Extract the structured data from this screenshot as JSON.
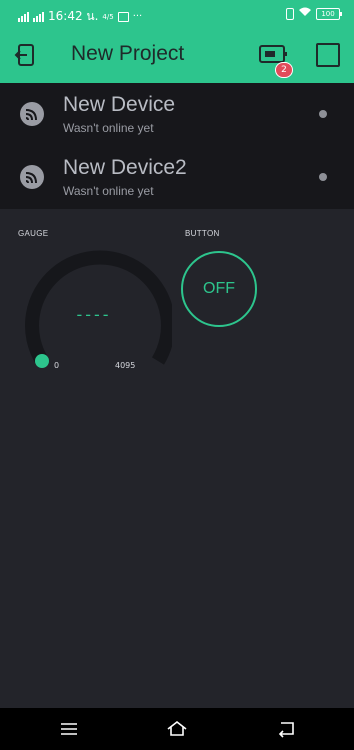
{
  "status_bar": {
    "time": "16:42 น.",
    "speed": "4/5",
    "battery": "100"
  },
  "app_bar": {
    "title": "New Project",
    "device_badge_count": "2"
  },
  "devices": [
    {
      "name": "New Device",
      "status": "Wasn't online yet"
    },
    {
      "name": "New Device2",
      "status": "Wasn't online yet"
    }
  ],
  "gauge": {
    "label": "GAUGE",
    "value": "----",
    "min": "0",
    "max": "4095"
  },
  "button": {
    "label": "BUTTON",
    "state": "OFF"
  },
  "colors": {
    "accent": "#2dc58d",
    "background": "#23242a",
    "device_list_bg": "#17171b",
    "badge": "#e14c5a"
  }
}
